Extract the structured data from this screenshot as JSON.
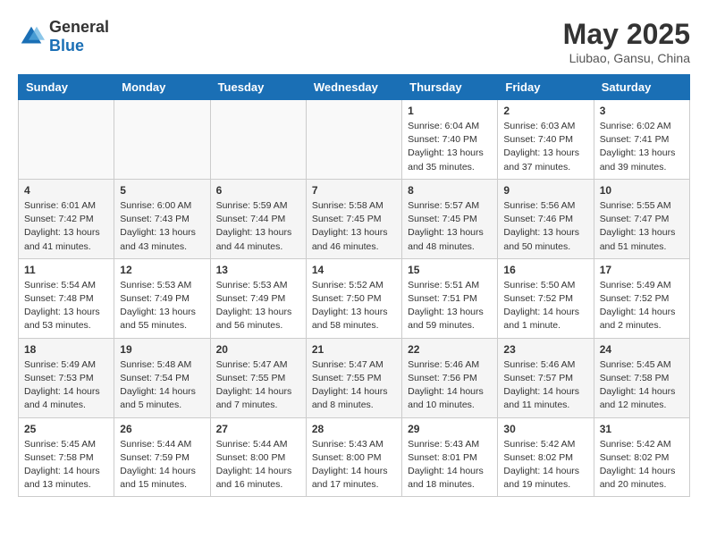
{
  "header": {
    "logo_general": "General",
    "logo_blue": "Blue",
    "month_title": "May 2025",
    "location": "Liubao, Gansu, China"
  },
  "days_of_week": [
    "Sunday",
    "Monday",
    "Tuesday",
    "Wednesday",
    "Thursday",
    "Friday",
    "Saturday"
  ],
  "weeks": [
    [
      {
        "day": "",
        "info": ""
      },
      {
        "day": "",
        "info": ""
      },
      {
        "day": "",
        "info": ""
      },
      {
        "day": "",
        "info": ""
      },
      {
        "day": "1",
        "info": "Sunrise: 6:04 AM\nSunset: 7:40 PM\nDaylight: 13 hours\nand 35 minutes."
      },
      {
        "day": "2",
        "info": "Sunrise: 6:03 AM\nSunset: 7:40 PM\nDaylight: 13 hours\nand 37 minutes."
      },
      {
        "day": "3",
        "info": "Sunrise: 6:02 AM\nSunset: 7:41 PM\nDaylight: 13 hours\nand 39 minutes."
      }
    ],
    [
      {
        "day": "4",
        "info": "Sunrise: 6:01 AM\nSunset: 7:42 PM\nDaylight: 13 hours\nand 41 minutes."
      },
      {
        "day": "5",
        "info": "Sunrise: 6:00 AM\nSunset: 7:43 PM\nDaylight: 13 hours\nand 43 minutes."
      },
      {
        "day": "6",
        "info": "Sunrise: 5:59 AM\nSunset: 7:44 PM\nDaylight: 13 hours\nand 44 minutes."
      },
      {
        "day": "7",
        "info": "Sunrise: 5:58 AM\nSunset: 7:45 PM\nDaylight: 13 hours\nand 46 minutes."
      },
      {
        "day": "8",
        "info": "Sunrise: 5:57 AM\nSunset: 7:45 PM\nDaylight: 13 hours\nand 48 minutes."
      },
      {
        "day": "9",
        "info": "Sunrise: 5:56 AM\nSunset: 7:46 PM\nDaylight: 13 hours\nand 50 minutes."
      },
      {
        "day": "10",
        "info": "Sunrise: 5:55 AM\nSunset: 7:47 PM\nDaylight: 13 hours\nand 51 minutes."
      }
    ],
    [
      {
        "day": "11",
        "info": "Sunrise: 5:54 AM\nSunset: 7:48 PM\nDaylight: 13 hours\nand 53 minutes."
      },
      {
        "day": "12",
        "info": "Sunrise: 5:53 AM\nSunset: 7:49 PM\nDaylight: 13 hours\nand 55 minutes."
      },
      {
        "day": "13",
        "info": "Sunrise: 5:53 AM\nSunset: 7:49 PM\nDaylight: 13 hours\nand 56 minutes."
      },
      {
        "day": "14",
        "info": "Sunrise: 5:52 AM\nSunset: 7:50 PM\nDaylight: 13 hours\nand 58 minutes."
      },
      {
        "day": "15",
        "info": "Sunrise: 5:51 AM\nSunset: 7:51 PM\nDaylight: 13 hours\nand 59 minutes."
      },
      {
        "day": "16",
        "info": "Sunrise: 5:50 AM\nSunset: 7:52 PM\nDaylight: 14 hours\nand 1 minute."
      },
      {
        "day": "17",
        "info": "Sunrise: 5:49 AM\nSunset: 7:52 PM\nDaylight: 14 hours\nand 2 minutes."
      }
    ],
    [
      {
        "day": "18",
        "info": "Sunrise: 5:49 AM\nSunset: 7:53 PM\nDaylight: 14 hours\nand 4 minutes."
      },
      {
        "day": "19",
        "info": "Sunrise: 5:48 AM\nSunset: 7:54 PM\nDaylight: 14 hours\nand 5 minutes."
      },
      {
        "day": "20",
        "info": "Sunrise: 5:47 AM\nSunset: 7:55 PM\nDaylight: 14 hours\nand 7 minutes."
      },
      {
        "day": "21",
        "info": "Sunrise: 5:47 AM\nSunset: 7:55 PM\nDaylight: 14 hours\nand 8 minutes."
      },
      {
        "day": "22",
        "info": "Sunrise: 5:46 AM\nSunset: 7:56 PM\nDaylight: 14 hours\nand 10 minutes."
      },
      {
        "day": "23",
        "info": "Sunrise: 5:46 AM\nSunset: 7:57 PM\nDaylight: 14 hours\nand 11 minutes."
      },
      {
        "day": "24",
        "info": "Sunrise: 5:45 AM\nSunset: 7:58 PM\nDaylight: 14 hours\nand 12 minutes."
      }
    ],
    [
      {
        "day": "25",
        "info": "Sunrise: 5:45 AM\nSunset: 7:58 PM\nDaylight: 14 hours\nand 13 minutes."
      },
      {
        "day": "26",
        "info": "Sunrise: 5:44 AM\nSunset: 7:59 PM\nDaylight: 14 hours\nand 15 minutes."
      },
      {
        "day": "27",
        "info": "Sunrise: 5:44 AM\nSunset: 8:00 PM\nDaylight: 14 hours\nand 16 minutes."
      },
      {
        "day": "28",
        "info": "Sunrise: 5:43 AM\nSunset: 8:00 PM\nDaylight: 14 hours\nand 17 minutes."
      },
      {
        "day": "29",
        "info": "Sunrise: 5:43 AM\nSunset: 8:01 PM\nDaylight: 14 hours\nand 18 minutes."
      },
      {
        "day": "30",
        "info": "Sunrise: 5:42 AM\nSunset: 8:02 PM\nDaylight: 14 hours\nand 19 minutes."
      },
      {
        "day": "31",
        "info": "Sunrise: 5:42 AM\nSunset: 8:02 PM\nDaylight: 14 hours\nand 20 minutes."
      }
    ]
  ]
}
